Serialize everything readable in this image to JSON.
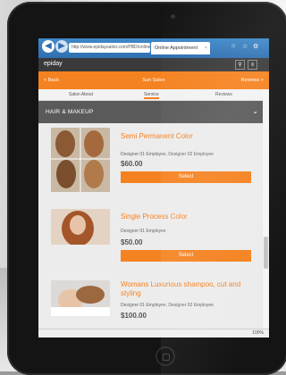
{
  "browser": {
    "url": "http://www.epidaysalon.com/PBD/online-app...",
    "tab_title": "Online Appointment",
    "tab_close": "×",
    "back_icon": "back-arrow-icon",
    "forward_icon": "forward-arrow-icon"
  },
  "site": {
    "logo": "epiday",
    "header_bar": {
      "back": "< Back",
      "title": "Sun Salon",
      "right": "Reviews >"
    },
    "subtabs": [
      "Salon About",
      "Service",
      "Reviews"
    ],
    "section_title": "HAIR & MAKEUP",
    "section_chevron": "⌄"
  },
  "services": [
    {
      "name": "Semi Permanent Color",
      "employees": "Designer 01 Employee, Designer 02 Employee",
      "price": "$60.00",
      "button": "Select"
    },
    {
      "name": "Single Process Color",
      "employees": "Designer 01 Employee",
      "price": "$50.00",
      "button": "Select"
    },
    {
      "name": "Womans Luxurious shampoo, cut and styling",
      "employees": "Designer 01 Employee, Designer 02 Employee",
      "price": "$100.00",
      "button": "Select"
    }
  ],
  "status": {
    "zoom": "100%"
  },
  "colors": {
    "accent": "#f58220",
    "header": "#3a3a3a",
    "browser_chrome": "#2f6fb0"
  }
}
